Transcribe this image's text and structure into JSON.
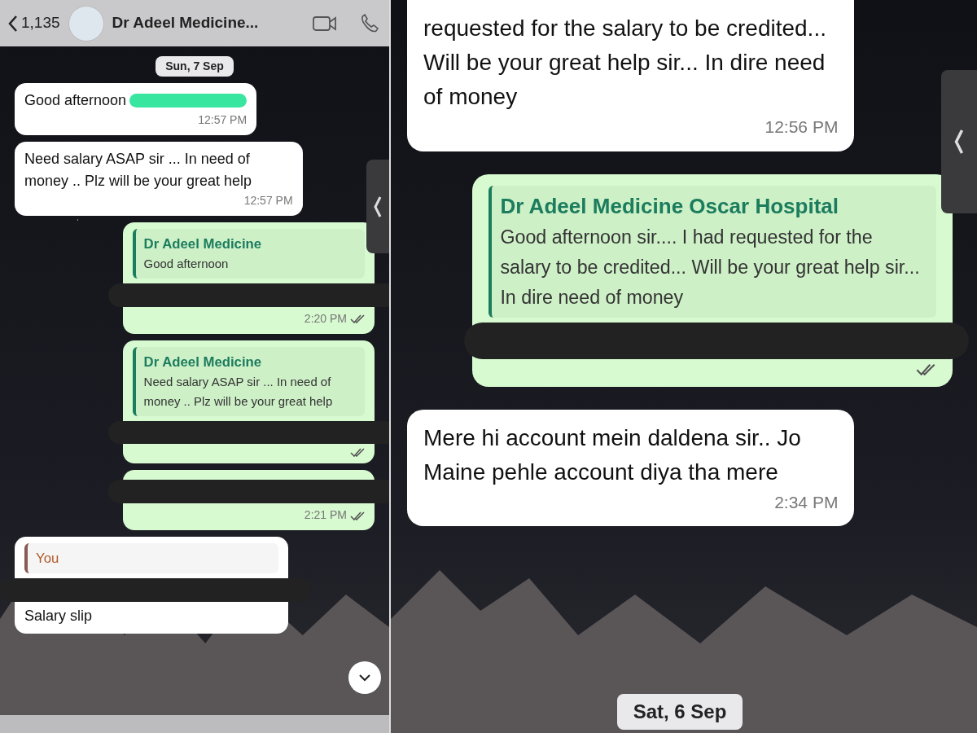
{
  "panels": [
    {
      "header": {
        "back_count": "1,135",
        "title": "Dr Adeel Medicine..."
      },
      "date_chip": "Sun, 7 Sep",
      "messages": [
        {
          "outgoing": false,
          "text": "Good afternoon",
          "highlighted": true,
          "time": "12:57 PM"
        },
        {
          "outgoing": false,
          "text": "Need salary ASAP sir ... In need of money .. Plz will be your great help",
          "time": "12:57 PM"
        },
        {
          "outgoing": true,
          "quote": {
            "author": "Dr Adeel Medicine",
            "text": "Good afternoon"
          },
          "redacted": true,
          "time": "2:20 PM",
          "read": true
        },
        {
          "outgoing": true,
          "quote": {
            "author": "Dr Adeel Medicine",
            "text": "Need salary ASAP sir ... In need of money .. Plz will be your great help"
          },
          "redacted": true,
          "read": true
        },
        {
          "outgoing": true,
          "redacted": true,
          "time": "2:21 PM",
          "read": true
        },
        {
          "outgoing": false,
          "quote": {
            "author": "You"
          },
          "redacted": true,
          "text": "Salary slip"
        }
      ],
      "scroll_down_button": true
    },
    {
      "messages": [
        {
          "outgoing": false,
          "text": "requested for the salary to be credited... Will be your great help sir... In dire need of money",
          "time": "12:56 PM"
        },
        {
          "outgoing": true,
          "quote": {
            "author": "Dr Adeel Medicine Oscar Hospital",
            "text": "Good afternoon sir.... I had requested for the salary to be credited... Will be your great help sir... In dire need of money"
          },
          "redacted": true,
          "read": true
        },
        {
          "outgoing": false,
          "text": "Mere hi account mein daldena sir.. Jo Maine pehle account diya tha mere",
          "time": "2:34 PM"
        }
      ],
      "bottom_date_chip": "Sat, 6 Sep"
    }
  ]
}
